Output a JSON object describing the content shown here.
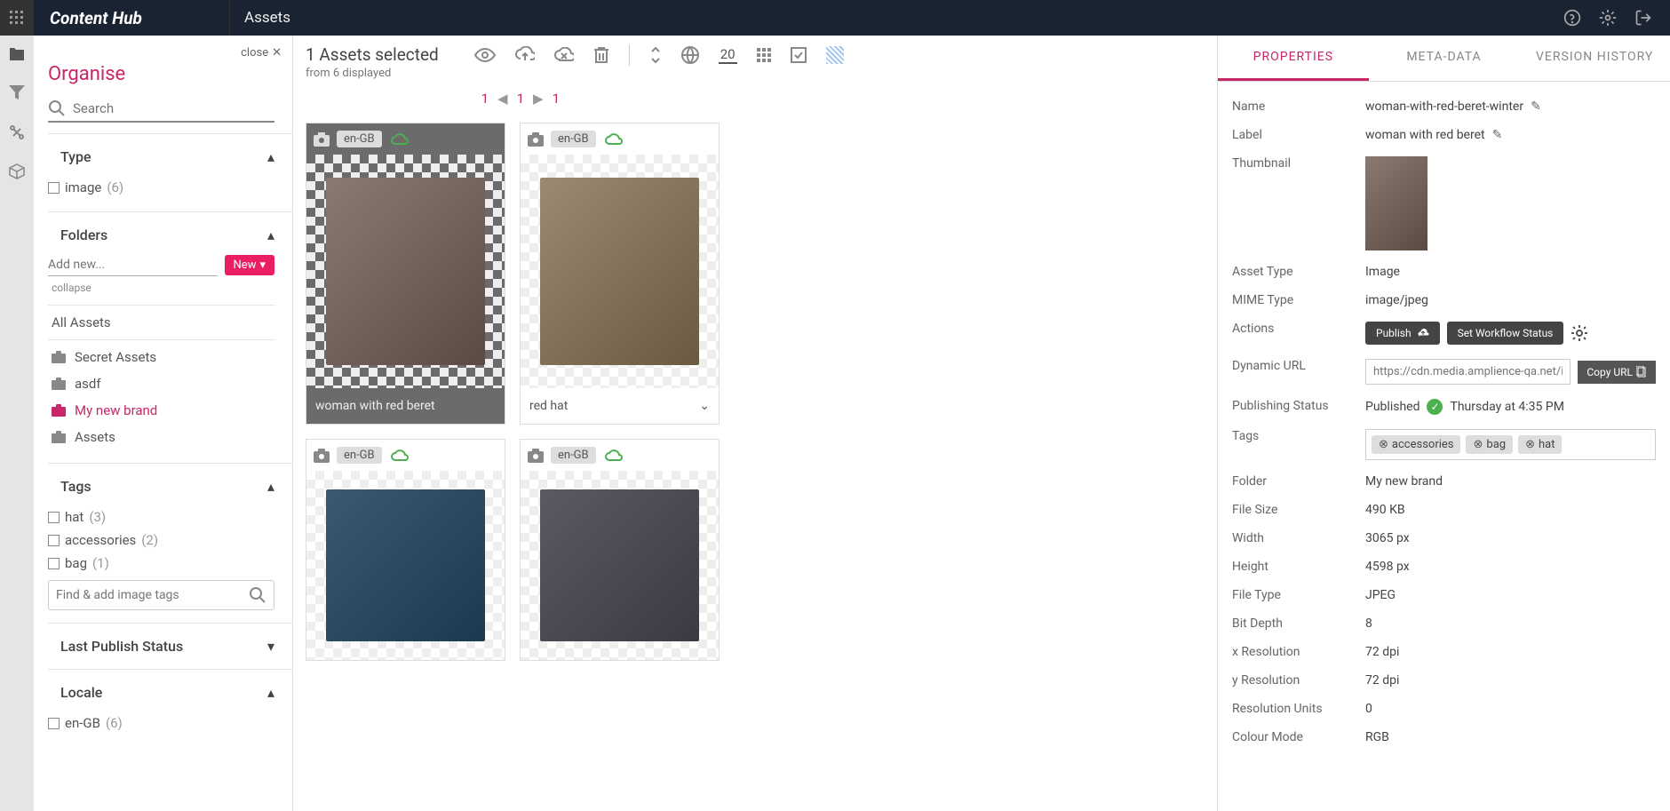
{
  "topbar": {
    "brand": "Content Hub",
    "page": "Assets"
  },
  "sidebar": {
    "close": "close",
    "title": "Organise",
    "search_placeholder": "Search",
    "type": {
      "label": "Type",
      "items": [
        {
          "label": "image",
          "count": "(6)"
        }
      ]
    },
    "folders": {
      "label": "Folders",
      "add_placeholder": "Add new...",
      "new_btn": "New",
      "collapse": "collapse",
      "all": "All Assets",
      "items": [
        {
          "label": "Secret Assets",
          "active": false
        },
        {
          "label": "asdf",
          "active": false
        },
        {
          "label": "My new brand",
          "active": true
        },
        {
          "label": "Assets",
          "active": false
        }
      ]
    },
    "tags": {
      "label": "Tags",
      "items": [
        {
          "label": "hat",
          "count": "(3)"
        },
        {
          "label": "accessories",
          "count": "(2)"
        },
        {
          "label": "bag",
          "count": "(1)"
        }
      ],
      "search_placeholder": "Find & add image tags"
    },
    "last_publish": {
      "label": "Last Publish Status"
    },
    "locale": {
      "label": "Locale",
      "items": [
        {
          "label": "en-GB",
          "count": "(6)"
        }
      ]
    }
  },
  "main": {
    "selected": "1 Assets selected",
    "displayed": "from 6 displayed",
    "page_size": "20",
    "paging": {
      "first": "1",
      "current": "1",
      "last": "1"
    },
    "cards": [
      {
        "locale": "en-GB",
        "name": "woman with red beret",
        "selected": true
      },
      {
        "locale": "en-GB",
        "name": "red hat",
        "selected": false
      },
      {
        "locale": "en-GB",
        "name": "",
        "selected": false
      },
      {
        "locale": "en-GB",
        "name": "",
        "selected": false
      }
    ]
  },
  "props": {
    "header": "PROPERTIES",
    "tabs": [
      "PROPERTIES",
      "META-DATA",
      "VERSION HISTORY"
    ],
    "fields": {
      "name_label": "Name",
      "name": "woman-with-red-beret-winter",
      "label_label": "Label",
      "label": "woman with red beret",
      "thumbnail_label": "Thumbnail",
      "asset_type_label": "Asset Type",
      "asset_type": "Image",
      "mime_label": "MIME Type",
      "mime": "image/jpeg",
      "actions_label": "Actions",
      "publish_btn": "Publish",
      "workflow_btn": "Set Workflow Status",
      "url_label": "Dynamic URL",
      "url_placeholder": "https://cdn.media.amplience-qa.net/i/l",
      "copy_btn": "Copy URL",
      "pubstatus_label": "Publishing Status",
      "pubstatus": "Published",
      "pubtime": "Thursday at 4:35 PM",
      "tags_label": "Tags",
      "tags": [
        "accessories",
        "bag",
        "hat"
      ],
      "folder_label": "Folder",
      "folder": "My new brand",
      "filesize_label": "File Size",
      "filesize": "490 KB",
      "width_label": "Width",
      "width": "3065 px",
      "height_label": "Height",
      "height": "4598 px",
      "filetype_label": "File Type",
      "filetype": "JPEG",
      "bitdepth_label": "Bit Depth",
      "bitdepth": "8",
      "xres_label": "x Resolution",
      "xres": "72 dpi",
      "yres_label": "y Resolution",
      "yres": "72 dpi",
      "resunits_label": "Resolution Units",
      "resunits": "0",
      "colour_label": "Colour Mode",
      "colour": "RGB"
    }
  }
}
